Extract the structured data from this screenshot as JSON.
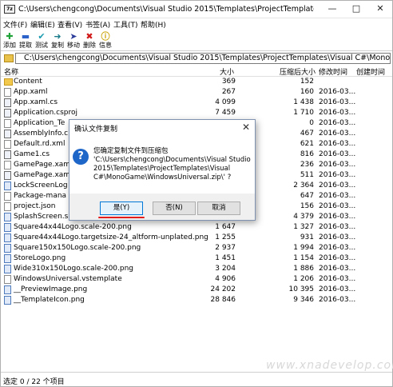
{
  "window": {
    "title": "C:\\Users\\chengcong\\Documents\\Visual Studio 2015\\Templates\\ProjectTemplates\\Visual C...",
    "app_icon": "7z"
  },
  "menu": [
    {
      "label": "文件(F)"
    },
    {
      "label": "编辑(E)"
    },
    {
      "label": "查看(V)"
    },
    {
      "label": "书签(A)"
    },
    {
      "label": "工具(T)"
    },
    {
      "label": "帮助(H)"
    }
  ],
  "toolbar": [
    {
      "label": "添加",
      "icon": "plus-icon",
      "color": "#22a33a"
    },
    {
      "label": "提取",
      "icon": "minus-icon",
      "color": "#2b62c9"
    },
    {
      "label": "测试",
      "icon": "check-icon",
      "color": "#1a9bb0"
    },
    {
      "label": "复制",
      "icon": "copy-arrow-icon",
      "color": "#1a7b8a"
    },
    {
      "label": "移动",
      "icon": "move-arrow-icon",
      "color": "#2b3c9a"
    },
    {
      "label": "删除",
      "icon": "delete-x-icon",
      "color": "#d11a1a"
    },
    {
      "label": "信息",
      "icon": "info-icon",
      "color": "#c9a000"
    }
  ],
  "path": "C:\\Users\\chengcong\\Documents\\Visual Studio 2015\\Templates\\ProjectTemplates\\Visual C#\\MonoGame\\Windo",
  "columns": {
    "name": "名称",
    "size": "大小",
    "packed": "压缩后大小",
    "modified": "修改时间",
    "created": "创建时间"
  },
  "files": [
    {
      "name": "Content",
      "size": "369",
      "packed": "152",
      "date": "",
      "type": "folder"
    },
    {
      "name": "App.xaml",
      "size": "267",
      "packed": "160",
      "date": "2016-03...",
      "type": "file"
    },
    {
      "name": "App.xaml.cs",
      "size": "4 099",
      "packed": "1 438",
      "date": "2016-03...",
      "type": "code"
    },
    {
      "name": "Application.csproj",
      "size": "7 459",
      "packed": "1 710",
      "date": "2016-03...",
      "type": "code"
    },
    {
      "name": "Application_Te",
      "size": "",
      "packed": "0",
      "date": "2016-03...",
      "type": "file"
    },
    {
      "name": "AssemblyInfo.c",
      "size": "",
      "packed": "467",
      "date": "2016-03...",
      "type": "code"
    },
    {
      "name": "Default.rd.xml",
      "size": "",
      "packed": "621",
      "date": "2016-03...",
      "type": "file"
    },
    {
      "name": "Game1.cs",
      "size": "",
      "packed": "816",
      "date": "2016-03...",
      "type": "code"
    },
    {
      "name": "GamePage.xam",
      "size": "",
      "packed": "236",
      "date": "2016-03...",
      "type": "file"
    },
    {
      "name": "GamePage.xam",
      "size": "",
      "packed": "511",
      "date": "2016-03...",
      "type": "code"
    },
    {
      "name": "LockScreenLog",
      "size": "",
      "packed": "2 364",
      "date": "2016-03...",
      "type": "png"
    },
    {
      "name": "Package-mana",
      "size": "",
      "packed": "647",
      "date": "2016-03...",
      "type": "file"
    },
    {
      "name": "project.json",
      "size": "",
      "packed": "156",
      "date": "2016-03...",
      "type": "file"
    },
    {
      "name": "SplashScreen.s",
      "size": "",
      "packed": "4 379",
      "date": "2016-03...",
      "type": "png"
    },
    {
      "name": "Square44x44Logo.scale-200.png",
      "size": "1 647",
      "packed": "1 327",
      "date": "2016-03...",
      "type": "png"
    },
    {
      "name": "Square44x44Logo.targetsize-24_altform-unplated.png",
      "size": "1 255",
      "packed": "931",
      "date": "2016-03...",
      "type": "png"
    },
    {
      "name": "Square150x150Logo.scale-200.png",
      "size": "2 937",
      "packed": "1 994",
      "date": "2016-03...",
      "type": "png"
    },
    {
      "name": "StoreLogo.png",
      "size": "1 451",
      "packed": "1 154",
      "date": "2016-03...",
      "type": "png"
    },
    {
      "name": "Wide310x150Logo.scale-200.png",
      "size": "3 204",
      "packed": "1 886",
      "date": "2016-03...",
      "type": "png"
    },
    {
      "name": "WindowsUniversal.vstemplate",
      "size": "4 906",
      "packed": "1 206",
      "date": "2016-03...",
      "type": "file"
    },
    {
      "name": "__PreviewImage.png",
      "size": "24 202",
      "packed": "10 395",
      "date": "2016-03...",
      "type": "png"
    },
    {
      "name": "__TemplateIcon.png",
      "size": "28 846",
      "packed": "9 346",
      "date": "2016-03...",
      "type": "png"
    }
  ],
  "status": "选定 0 / 22 个项目",
  "watermark": "www.xnadevelop.com",
  "dialog": {
    "title": "确认文件复制",
    "message_lines": [
      "您确定复制文件到压缩包",
      "'C:\\Users\\chengcong\\Documents\\Visual Studio",
      "2015\\Templates\\ProjectTemplates\\Visual",
      "C#\\MonoGame\\WindowsUniversal.zip\\' ?"
    ],
    "yes": "是(Y)",
    "no": "否(N)",
    "cancel": "取消"
  }
}
